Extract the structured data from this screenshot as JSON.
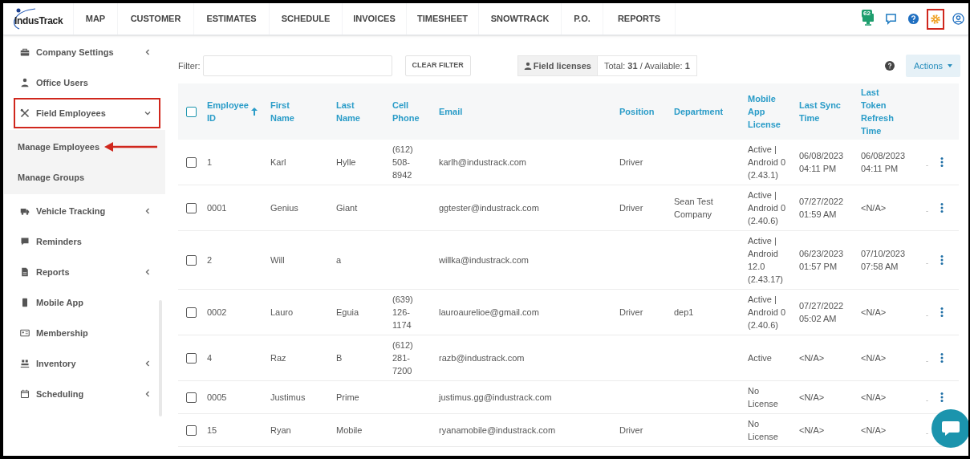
{
  "nav": {
    "logo": "IndusTrack",
    "items": [
      {
        "label": "MAP"
      },
      {
        "label": "CUSTOMER"
      },
      {
        "label": "ESTIMATES"
      },
      {
        "label": "SCHEDULE"
      },
      {
        "label": "INVOICES"
      },
      {
        "label": "TIMESHEET"
      },
      {
        "label": "SNOWTRACK"
      },
      {
        "label": "P.O."
      },
      {
        "label": "REPORTS"
      }
    ],
    "icons": [
      {
        "kind": "notifications",
        "badge": "62",
        "highlighted": false
      },
      {
        "kind": "chat",
        "highlighted": false
      },
      {
        "kind": "help",
        "highlighted": false
      },
      {
        "kind": "settings",
        "highlighted": true
      },
      {
        "kind": "profile",
        "highlighted": false
      }
    ]
  },
  "sidebar": {
    "items": [
      {
        "label": "Company Settings",
        "expanded": false,
        "highlighted": false
      },
      {
        "label": "Office Users",
        "highlighted": false
      },
      {
        "label": "Field Employees",
        "expanded": true,
        "highlighted": true,
        "children": [
          {
            "label": "Manage Employees",
            "pointed": true
          },
          {
            "label": "Manage Groups",
            "pointed": false
          }
        ]
      },
      {
        "label": "Vehicle Tracking",
        "expanded": false,
        "highlighted": false
      },
      {
        "label": "Reminders",
        "highlighted": false
      },
      {
        "label": "Reports",
        "expanded": false,
        "highlighted": false
      },
      {
        "label": "Mobile App",
        "highlighted": false
      },
      {
        "label": "Membership",
        "highlighted": false
      },
      {
        "label": "Inventory",
        "expanded": false,
        "highlighted": false
      },
      {
        "label": "Scheduling",
        "expanded": false,
        "highlighted": false
      }
    ]
  },
  "toolbar": {
    "filter_label": "Filter:",
    "clear_button": "CLEAR FILTER",
    "licenses_button": "Field licenses",
    "licenses_summary": "Total: **31** / Available: **1**",
    "actions_button": "Actions"
  },
  "table": {
    "header_checked": false,
    "columns": [
      {
        "label": "Employee ID",
        "sorted": true
      },
      {
        "label": "First Name"
      },
      {
        "label": "Last Name"
      },
      {
        "label": "Cell Phone"
      },
      {
        "label": "Email"
      },
      {
        "label": "Position"
      },
      {
        "label": "Department"
      },
      {
        "label": "Mobile App License"
      },
      {
        "label": "Last Sync Time"
      },
      {
        "label": "Last Token Refresh Time"
      }
    ],
    "rows": [
      {
        "checked": false,
        "cells": [
          "1",
          "Karl",
          "Hylle",
          "(612) 508-8942",
          "karlh@industrack.com",
          "Driver",
          "",
          "Active | Android 0 (2.43.1)",
          "06/08/2023 04:11 PM",
          "06/08/2023 04:11 PM"
        ],
        "column_11": "-"
      },
      {
        "checked": false,
        "cells": [
          "0001",
          "Genius",
          "Giant",
          "",
          "ggtester@industrack.com",
          "Driver",
          "Sean Test Company",
          "Active | Android 0 (2.40.6)",
          "07/27/2022 01:59 AM",
          "<N/A>"
        ],
        "column_11": "-"
      },
      {
        "checked": false,
        "cells": [
          "2",
          "Will",
          "a",
          "",
          "willka@industrack.com",
          "",
          "",
          "Active | Android 12.0 (2.43.17)",
          "06/23/2023 01:57 PM",
          "07/10/2023 07:58 AM"
        ],
        "column_11": "-"
      },
      {
        "checked": false,
        "cells": [
          "0002",
          "Lauro",
          "Eguia",
          "(639) 126-1174",
          "lauroaurelioe@gmail.com",
          "Driver",
          "dep1",
          "Active | Android 0 (2.40.6)",
          "07/27/2022 05:02 AM",
          "<N/A>"
        ],
        "column_11": "-"
      },
      {
        "checked": false,
        "cells": [
          "4",
          "Raz",
          "B",
          "(612) 281-7200",
          "razb@industrack.com",
          "",
          "",
          "Active",
          "<N/A>",
          "<N/A>"
        ],
        "column_11": "-"
      },
      {
        "checked": false,
        "cells": [
          "0005",
          "Justimus",
          "Prime",
          "",
          "justimus.gg@industrack.com",
          "",
          "",
          "No License",
          "<N/A>",
          "<N/A>"
        ],
        "column_11": "-"
      },
      {
        "checked": false,
        "cells": [
          "15",
          "Ryan",
          "Mobile",
          "",
          "ryanamobile@industrack.com",
          "Driver",
          "",
          "No License",
          "<N/A>",
          "<N/A>"
        ],
        "column_11": "-",
        "menu": false
      }
    ]
  }
}
